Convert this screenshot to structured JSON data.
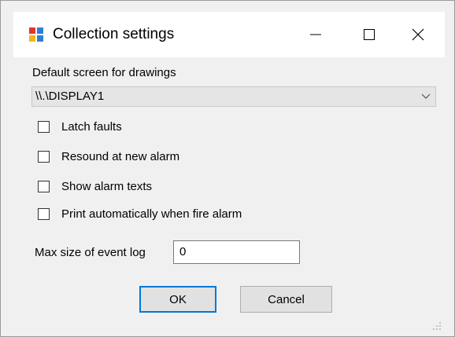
{
  "window": {
    "title": "Collection settings",
    "icon": "app-window-icon",
    "controls": {
      "minimize": "minimize-icon",
      "maximize": "maximize-icon",
      "close": "close-icon"
    }
  },
  "form": {
    "screen_label": "Default screen for drawings",
    "screen_value": "\\\\.\\DISPLAY1",
    "checkboxes": [
      {
        "label": "Latch faults",
        "checked": false
      },
      {
        "label": "Resound at new alarm",
        "checked": false
      },
      {
        "label": "Show alarm texts",
        "checked": false
      },
      {
        "label": "Print automatically when fire alarm",
        "checked": false
      }
    ],
    "event_log_label": "Max size of event log",
    "event_log_value": "0"
  },
  "buttons": {
    "ok": "OK",
    "cancel": "Cancel"
  }
}
